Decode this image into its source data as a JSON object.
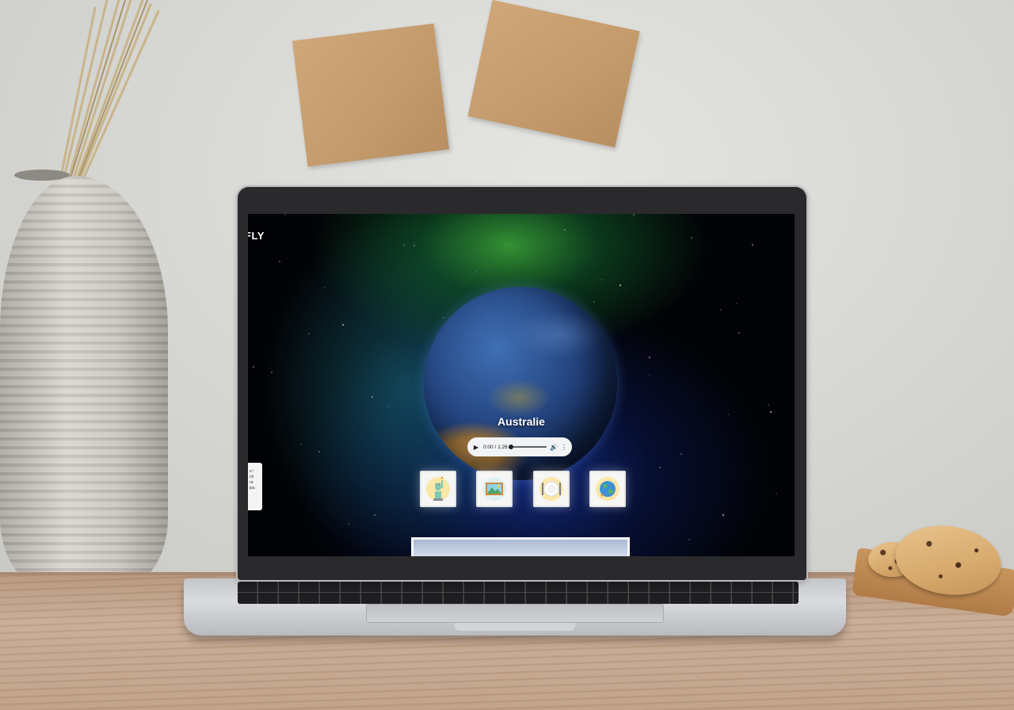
{
  "app": {
    "brand": "FLY"
  },
  "sidebar_tab": {
    "lines": [
      "e !",
      "ch",
      "ra",
      "",
      "ipa"
    ]
  },
  "main": {
    "country_title": "Australie"
  },
  "audio_player": {
    "time": "0:00 / 1:26",
    "progress": 0
  },
  "categories": [
    {
      "icon": "statue-of-liberty-icon"
    },
    {
      "icon": "landscape-picture-icon"
    },
    {
      "icon": "plate-cutlery-icon"
    },
    {
      "icon": "globe-icon"
    }
  ],
  "colors": {
    "space_background": "#020306",
    "nebula_green": "#3caa3c",
    "nebula_blue": "#1937a0",
    "player_background": "#f1f3f4"
  }
}
